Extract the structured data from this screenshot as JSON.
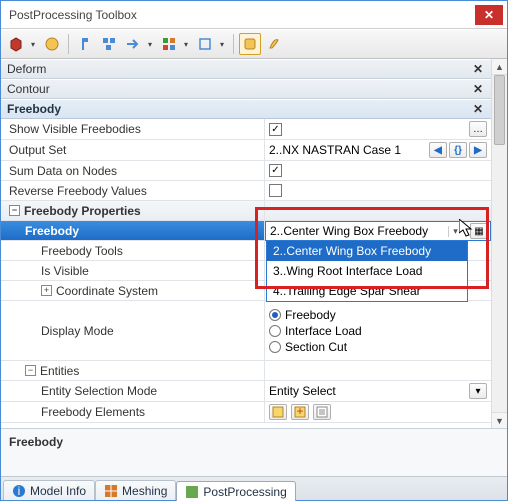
{
  "window": {
    "title": "PostProcessing Toolbox"
  },
  "toolbar_icons": [
    "cube",
    "fan",
    "lbrace",
    "tree",
    "arrow",
    "grid",
    "box",
    "wand",
    "brush"
  ],
  "sections": {
    "deform": "Deform",
    "contour": "Contour",
    "freebody": "Freebody"
  },
  "rows": {
    "show_visible": {
      "label": "Show Visible Freebodies",
      "checked": true
    },
    "output_set": {
      "label": "Output Set",
      "value": "2..NX NASTRAN Case 1"
    },
    "sum_data": {
      "label": "Sum Data on Nodes",
      "checked": true
    },
    "reverse": {
      "label": "Reverse Freebody Values",
      "checked": false
    },
    "cat_fbprops": "Freebody Properties",
    "freebody_sel": {
      "label": "Freebody",
      "value": "2..Center Wing Box Freebody",
      "options": [
        "2..Center Wing Box Freebody",
        "3..Wing Root Interface Load",
        "4..Trailing Edge Spar Shear"
      ]
    },
    "fb_tools": "Freebody Tools",
    "is_visible": "Is Visible",
    "coord_sys": "Coordinate System",
    "display_mode": {
      "label": "Display Mode",
      "options": [
        "Freebody",
        "Interface Load",
        "Section Cut"
      ],
      "selected": 0
    },
    "entities": "Entities",
    "ent_sel_mode": {
      "label": "Entity Selection Mode",
      "value": "Entity Select"
    },
    "fb_elements": "Freebody Elements"
  },
  "description": "Freebody",
  "tabs": [
    {
      "label": "Model Info",
      "icon": "#2a7ad1",
      "active": false
    },
    {
      "label": "Meshing",
      "icon": "#d47a2a",
      "active": false
    },
    {
      "label": "PostProcessing",
      "icon": "#6aa84f",
      "active": true
    }
  ]
}
